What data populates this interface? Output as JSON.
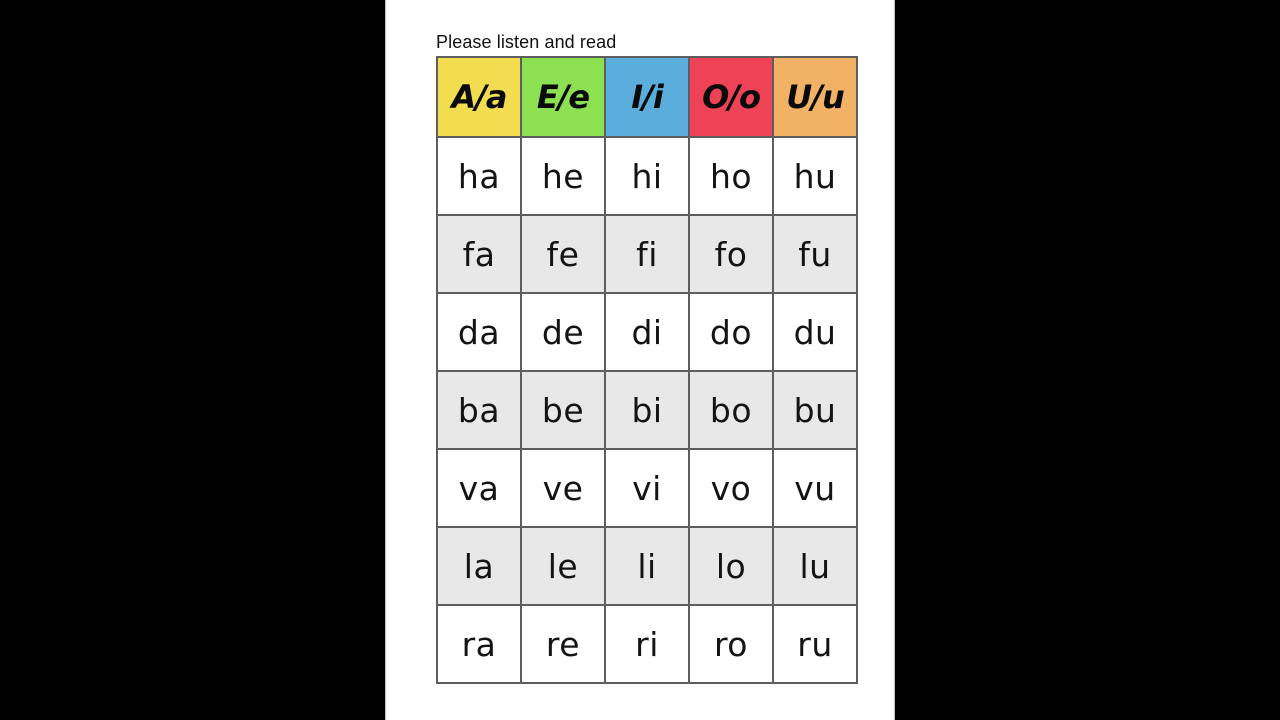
{
  "slide": {
    "instruction": "Please listen and read",
    "background_color": "#000000",
    "page_color": "#ffffff"
  },
  "chart_data": {
    "type": "table",
    "title": "Please listen and read",
    "columns": [
      "A/a",
      "E/e",
      "I/i",
      "O/o",
      "U/u"
    ],
    "column_colors": [
      "#f2dc50",
      "#8ce051",
      "#5baedb",
      "#ee4257",
      "#f2b266"
    ],
    "row_consonants": [
      "h",
      "f",
      "d",
      "b",
      "v",
      "l",
      "r"
    ],
    "rows": [
      [
        "ha",
        "he",
        "hi",
        "ho",
        "hu"
      ],
      [
        "fa",
        "fe",
        "fi",
        "fo",
        "fu"
      ],
      [
        "da",
        "de",
        "di",
        "do",
        "du"
      ],
      [
        "ba",
        "be",
        "bi",
        "bo",
        "bu"
      ],
      [
        "va",
        "ve",
        "vi",
        "vo",
        "vu"
      ],
      [
        "la",
        "le",
        "li",
        "lo",
        "lu"
      ],
      [
        "ra",
        "re",
        "ri",
        "ro",
        "ru"
      ]
    ],
    "row_shading": [
      "light",
      "shaded",
      "light",
      "shaded",
      "light",
      "shaded",
      "light"
    ],
    "shaded_row_color": "#e8e8e8",
    "light_row_color": "#ffffff",
    "border_color": "#5e5e5e"
  }
}
